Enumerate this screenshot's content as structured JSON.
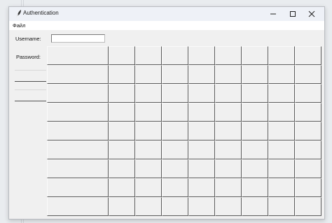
{
  "window": {
    "title": "Authentication"
  },
  "menu": {
    "items": [
      "Файл"
    ]
  },
  "form": {
    "username_label": "Username:",
    "username_value": "",
    "password_label": "Password:"
  },
  "grid": {
    "rows": 9,
    "columns": 9
  },
  "icons": {
    "app": "feather-icon",
    "minimize": "minimize-icon",
    "maximize": "maximize-icon",
    "close": "close-icon"
  },
  "colors": {
    "window_bg": "#f0f0f0",
    "titlebar_bg": "#eef1f7",
    "menubar_bg": "#ffffff"
  }
}
